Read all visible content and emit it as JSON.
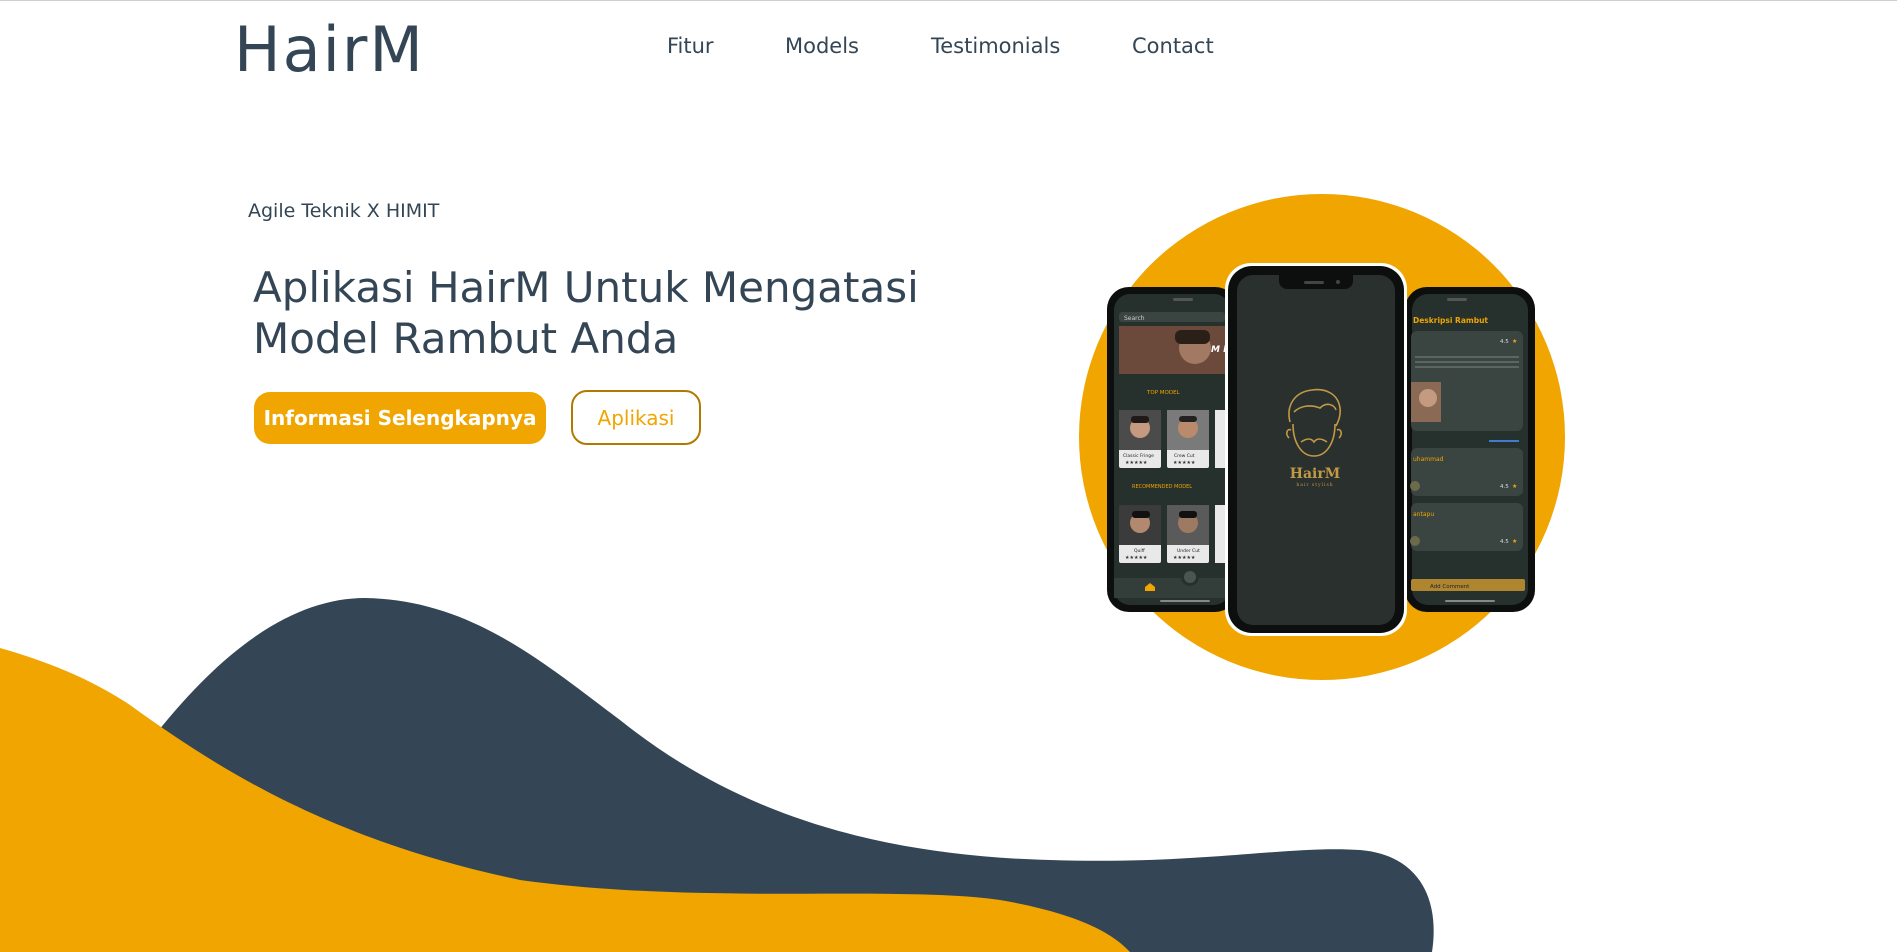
{
  "brand": {
    "logo": "HairM"
  },
  "nav": {
    "items": [
      {
        "label": "Fitur"
      },
      {
        "label": "Models"
      },
      {
        "label": "Testimonials"
      },
      {
        "label": "Contact"
      }
    ]
  },
  "hero": {
    "subtitle": "Agile Teknik X HIMIT",
    "title": "Aplikasi HairM Untuk Mengatasi Model Rambut Anda",
    "primary_button": "Informasi Selengkapnya",
    "secondary_button": "Aplikasi"
  },
  "phone_left": {
    "search": "Search",
    "banner_text": "M haj",
    "top_model_label": "TOP MODEL",
    "top_models": [
      "Classic Fringe",
      "Crew Cut"
    ],
    "recommended_label": "RECOMMENDED MODEL",
    "recommended_models": [
      "Quiff",
      "Under Cut"
    ]
  },
  "phone_center": {
    "app_name": "HairM",
    "tagline": "hair stylish"
  },
  "phone_right": {
    "header": "Deskripsi Rambut",
    "rating": "4.5",
    "comment_1_name": "uhammad",
    "comment_1_rating": "4.5",
    "comment_2_name": "antapu",
    "comment_2_rating": "4.5",
    "add_comment": "Add Comment"
  },
  "colors": {
    "accent": "#f0a500",
    "dark": "#344655",
    "phone_screen": "#2a302e",
    "white": "#ffffff"
  }
}
